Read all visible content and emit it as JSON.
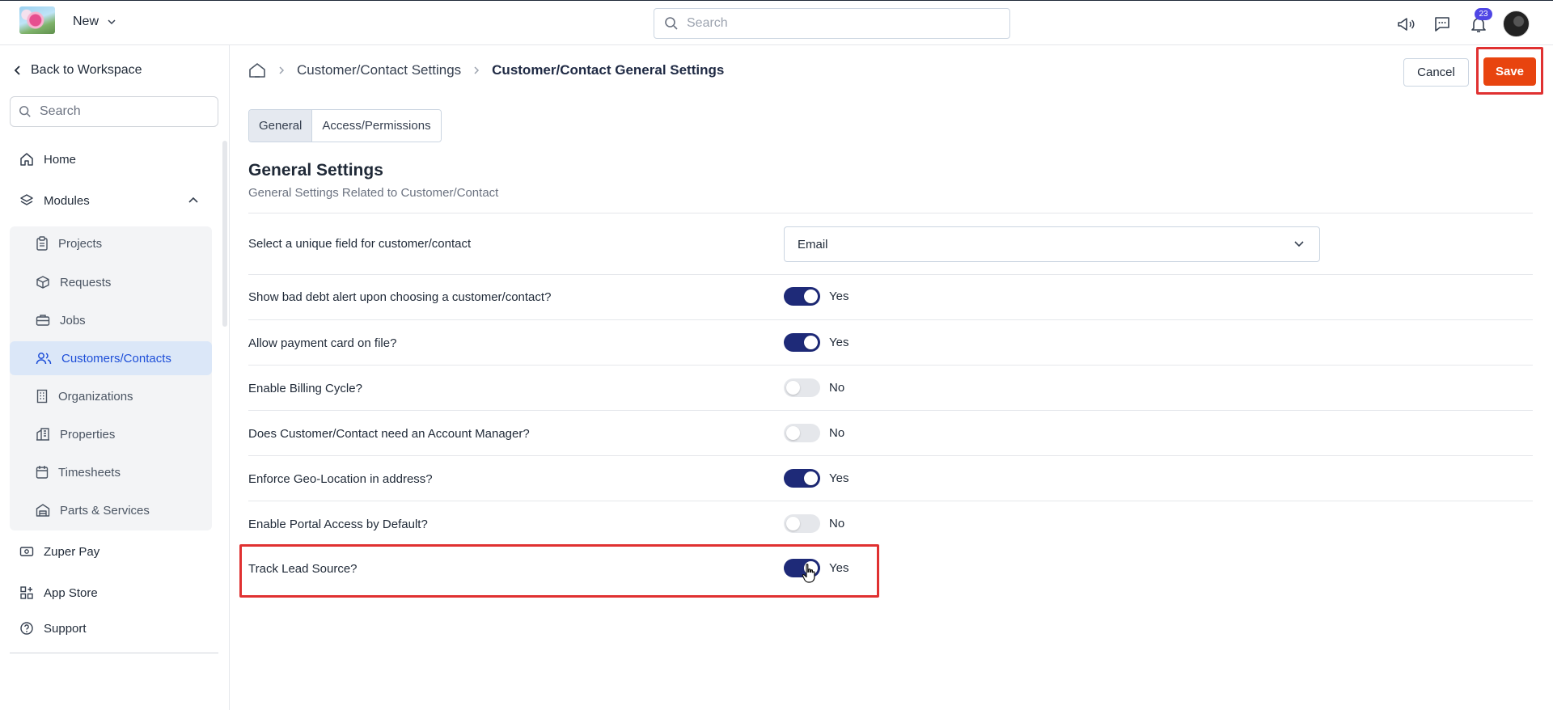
{
  "topbar": {
    "new_label": "New",
    "search_placeholder": "Search",
    "notification_count": "23"
  },
  "sidebar": {
    "back_label": "Back to Workspace",
    "search_placeholder": "Search",
    "home_label": "Home",
    "modules_label": "Modules",
    "modules": [
      {
        "label": "Projects",
        "icon": "clipboard-icon"
      },
      {
        "label": "Requests",
        "icon": "box-icon"
      },
      {
        "label": "Jobs",
        "icon": "briefcase-icon"
      },
      {
        "label": "Customers/Contacts",
        "icon": "users-icon",
        "active": true
      },
      {
        "label": "Organizations",
        "icon": "building-icon"
      },
      {
        "label": "Properties",
        "icon": "property-icon"
      },
      {
        "label": "Timesheets",
        "icon": "calendar-icon"
      },
      {
        "label": "Parts & Services",
        "icon": "warehouse-icon"
      }
    ],
    "zuper_pay_label": "Zuper Pay",
    "app_store_label": "App Store",
    "support_label": "Support"
  },
  "breadcrumb": {
    "parent": "Customer/Contact Settings",
    "current": "Customer/Contact General Settings"
  },
  "actions": {
    "cancel_label": "Cancel",
    "save_label": "Save"
  },
  "tabs": {
    "general": "General",
    "access": "Access/Permissions"
  },
  "section": {
    "title": "General Settings",
    "subtitle": "General Settings Related to Customer/Contact"
  },
  "settings": {
    "unique_field": {
      "label": "Select a unique field for customer/contact",
      "value": "Email"
    },
    "bad_debt": {
      "label": "Show bad debt alert upon choosing a customer/contact?",
      "value": "Yes",
      "on": true
    },
    "payment_card": {
      "label": "Allow payment card on file?",
      "value": "Yes",
      "on": true
    },
    "billing_cycle": {
      "label": "Enable Billing Cycle?",
      "value": "No",
      "on": false
    },
    "account_manager": {
      "label": "Does Customer/Contact need an Account Manager?",
      "value": "No",
      "on": false
    },
    "geo_location": {
      "label": "Enforce Geo-Location in address?",
      "value": "Yes",
      "on": true
    },
    "portal_access": {
      "label": "Enable Portal Access by Default?",
      "value": "No",
      "on": false
    },
    "lead_source": {
      "label": "Track Lead Source?",
      "value": "Yes",
      "on": true
    }
  },
  "colors": {
    "accent": "#1e2a78",
    "save": "#e8440f",
    "highlight": "#e03131",
    "active_nav": "#1d4ed8"
  }
}
